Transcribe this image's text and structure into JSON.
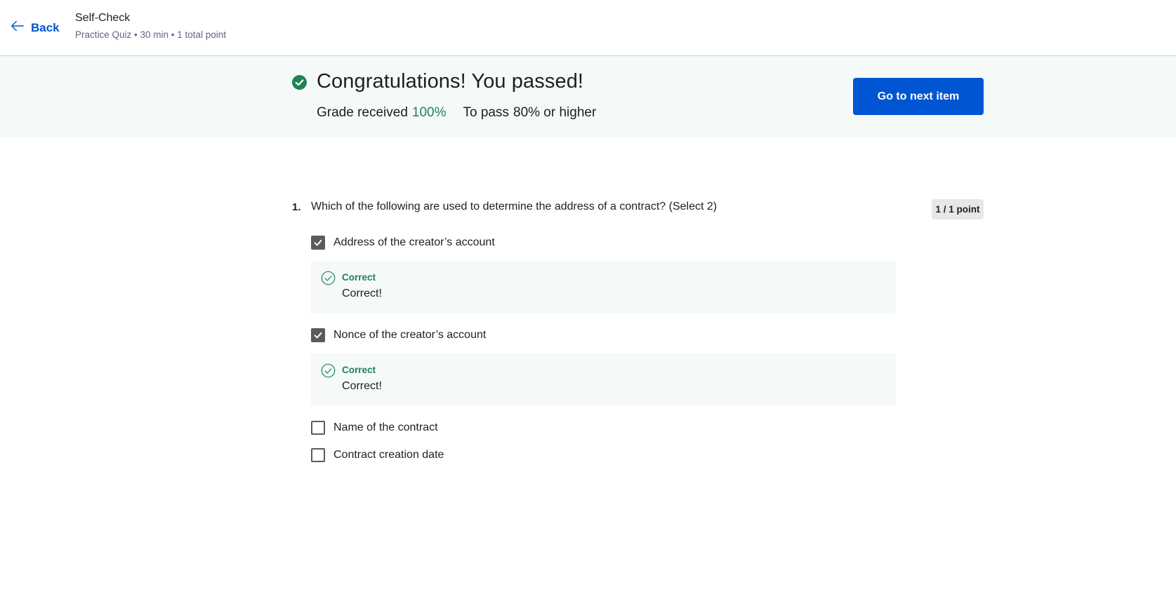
{
  "header": {
    "back_label": "Back",
    "title": "Self-Check",
    "subtitle": "Practice Quiz • 30 min • 1 total point"
  },
  "result": {
    "headline": "Congratulations! You passed!",
    "grade_label": "Grade received",
    "grade_value": "100%",
    "pass_label": "To pass",
    "pass_value": "80% or higher",
    "next_button": "Go to next item"
  },
  "question": {
    "number": "1.",
    "text": "Which of the following are used to determine the address of a contract? (Select 2)",
    "points": "1 / 1 point",
    "options": [
      {
        "label": "Address of the creator’s account",
        "checked": true,
        "feedback_title": "Correct",
        "feedback_text": "Correct!"
      },
      {
        "label": "Nonce of the creator’s account",
        "checked": true,
        "feedback_title": "Correct",
        "feedback_text": "Correct!"
      },
      {
        "label": "Name of the contract",
        "checked": false
      },
      {
        "label": "Contract creation date",
        "checked": false
      }
    ]
  },
  "colors": {
    "accent": "#0056d2",
    "success": "#1f8354",
    "banner_bg": "#f5f9f8"
  }
}
